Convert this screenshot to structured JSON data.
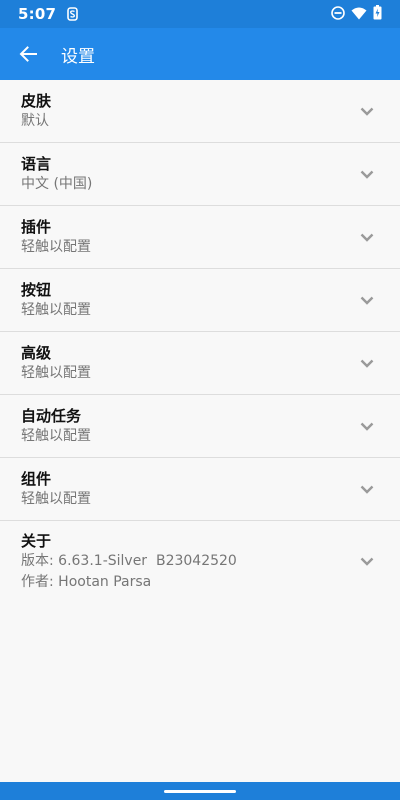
{
  "status_bar": {
    "time": "5:07",
    "icons": [
      "notification-s-icon",
      "do-not-disturb-icon",
      "wifi-icon",
      "battery-charging-icon"
    ]
  },
  "app_bar": {
    "title": "设置",
    "back_icon": "arrow-left-icon"
  },
  "settings": {
    "items": [
      {
        "title": "皮肤",
        "subtitle": "默认"
      },
      {
        "title": "语言",
        "subtitle": "中文 (中国)"
      },
      {
        "title": "插件",
        "subtitle": "轻触以配置"
      },
      {
        "title": "按钮",
        "subtitle": "轻触以配置"
      },
      {
        "title": "高级",
        "subtitle": "轻触以配置"
      },
      {
        "title": "自动任务",
        "subtitle": "轻触以配置"
      },
      {
        "title": "组件",
        "subtitle": "轻触以配置"
      }
    ],
    "about": {
      "title": "关于",
      "version": "版本: 6.63.1-Silver  B23042520",
      "author": "作者: Hootan Parsa"
    }
  },
  "colors": {
    "status_bar": "#1e7fd9",
    "app_bar": "#2389e9",
    "background": "#f8f8f8",
    "divider": "#dddddd"
  }
}
